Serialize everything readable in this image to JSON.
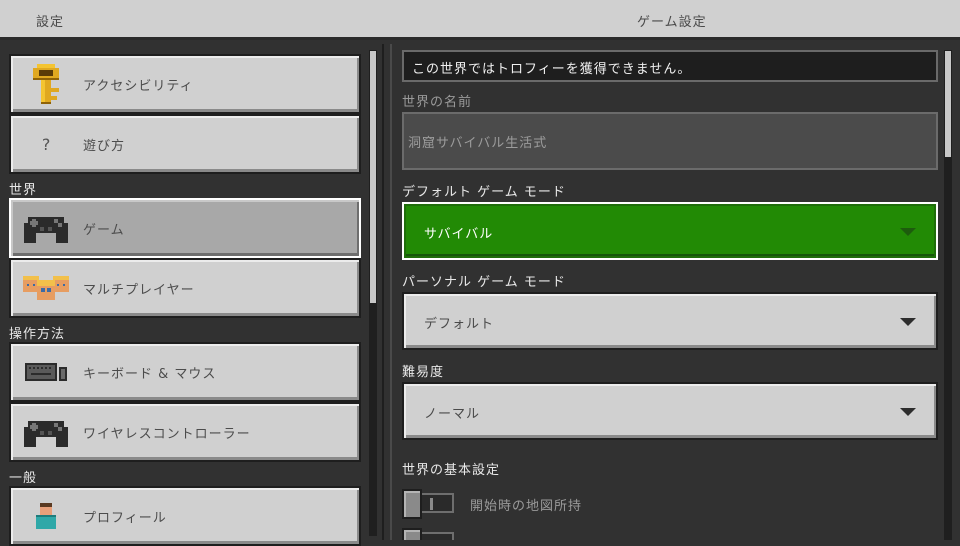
{
  "header": {
    "left_title": "設定",
    "center_title": "ゲーム設定"
  },
  "sidebar": {
    "items": [
      {
        "label": "アクセシビリティ",
        "icon": "key-icon"
      },
      {
        "label": "遊び方",
        "icon": "question-icon",
        "glyph": "?"
      },
      {
        "label": "ゲーム",
        "icon": "controller-icon",
        "selected": true
      },
      {
        "label": "マルチプレイヤー",
        "icon": "players-icon"
      },
      {
        "label": "キーボード & マウス",
        "icon": "keyboard-mouse-icon"
      },
      {
        "label": "ワイヤレスコントローラー",
        "icon": "controller-icon"
      },
      {
        "label": "プロフィール",
        "icon": "profile-icon"
      }
    ],
    "sections": {
      "world": "世界",
      "controls": "操作方法",
      "general": "一般"
    }
  },
  "main": {
    "notice": "この世界ではトロフィーを獲得できません。",
    "world_name": {
      "label": "世界の名前",
      "value": "洞窟サバイバル生活式"
    },
    "default_game_mode": {
      "label": "デフォルト ゲーム モード",
      "value": "サバイバル"
    },
    "personal_game_mode": {
      "label": "パーソナル ゲーム モード",
      "value": "デフォルト"
    },
    "difficulty": {
      "label": "難易度",
      "value": "ノーマル"
    },
    "basic_settings": {
      "label": "世界の基本設定",
      "toggles": [
        {
          "label": "開始時の地図所持",
          "on": false
        }
      ]
    }
  },
  "colors": {
    "accent": "#228a05",
    "panel": "#313131",
    "button": "#d0d0d0"
  }
}
